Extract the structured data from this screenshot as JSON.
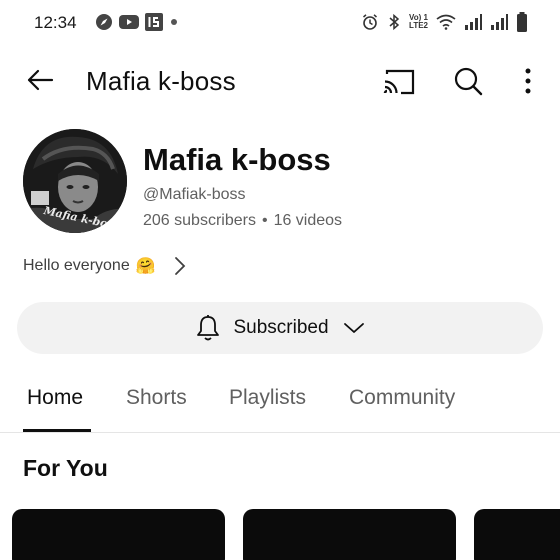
{
  "status_bar": {
    "time": "12:34",
    "network_label_top": "Vo) 1",
    "network_label_bottom": "LTE2",
    "left_icons": [
      "compass-icon",
      "youtube-icon",
      "app-s-icon",
      "notification-dot"
    ],
    "right_icons": [
      "alarm-icon",
      "bluetooth-icon",
      "volte-icon",
      "wifi-icon",
      "signal-icon",
      "signal-icon",
      "battery-icon"
    ]
  },
  "app_bar": {
    "title": "Mafia k-boss",
    "icons": [
      "back-arrow-icon",
      "cast-icon",
      "search-icon",
      "more-vert-icon"
    ]
  },
  "channel": {
    "name": "Mafia k-boss",
    "handle": "@Mafiak-boss",
    "subscribers": "206 subscribers",
    "separator": "•",
    "videos": "16 videos",
    "avatar_watermark": "Mafia k-boss",
    "description": "Hello everyone",
    "description_emoji": "🤗"
  },
  "subscribe_button": {
    "label": "Subscribed",
    "icons": [
      "bell-icon",
      "chevron-down-icon"
    ]
  },
  "tabs": [
    {
      "label": "Home",
      "active": true
    },
    {
      "label": "Shorts",
      "active": false
    },
    {
      "label": "Playlists",
      "active": false
    },
    {
      "label": "Community",
      "active": false
    }
  ],
  "section": {
    "title": "For You"
  },
  "colors": {
    "text_primary": "#0f0f0f",
    "text_secondary": "#606060",
    "button_bg": "#f2f2f2",
    "thumbnail_bg": "#0b0b0b"
  }
}
